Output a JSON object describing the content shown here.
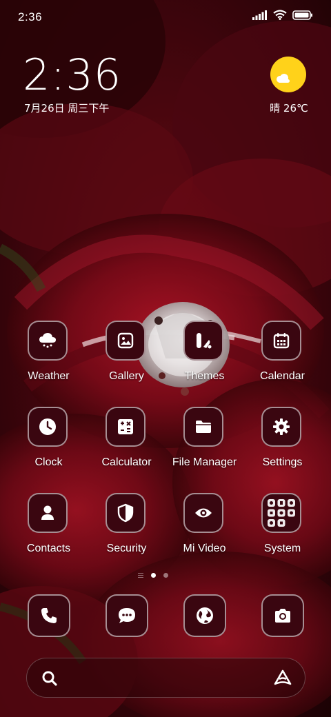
{
  "status_bar": {
    "time": "2:36",
    "icons": [
      "signal-icon",
      "wifi-icon",
      "battery-icon"
    ]
  },
  "clock_widget": {
    "time": "2:36",
    "date": "7月26日 周三下午"
  },
  "weather_widget": {
    "text": "晴 26℃",
    "icon": "sunny-icon"
  },
  "apps": [
    {
      "label": "Weather",
      "icon": "cloud-hail-icon"
    },
    {
      "label": "Gallery",
      "icon": "image-icon"
    },
    {
      "label": "Themes",
      "icon": "themes-icon"
    },
    {
      "label": "Calendar",
      "icon": "calendar-icon"
    },
    {
      "label": "Clock",
      "icon": "clock-icon"
    },
    {
      "label": "Calculator",
      "icon": "calculator-icon"
    },
    {
      "label": "File Manager",
      "icon": "folder-icon"
    },
    {
      "label": "Settings",
      "icon": "gear-icon"
    },
    {
      "label": "Contacts",
      "icon": "person-icon"
    },
    {
      "label": "Security",
      "icon": "shield-icon"
    },
    {
      "label": "Mi Video",
      "icon": "eye-icon"
    },
    {
      "label": "System",
      "icon": "folder-grid-icon"
    }
  ],
  "page_indicator": {
    "pages": 2,
    "active": 1
  },
  "dock": [
    "phone-icon",
    "messages-icon",
    "browser-globe-icon",
    "camera-icon"
  ],
  "search_bar": {
    "left_icon": "search-icon",
    "right_icon": "assistant-icon"
  },
  "colors": {
    "tile_bg": "#3a0610",
    "sun": "#ffd21a",
    "wallpaper_red": "#8a0d1c"
  }
}
